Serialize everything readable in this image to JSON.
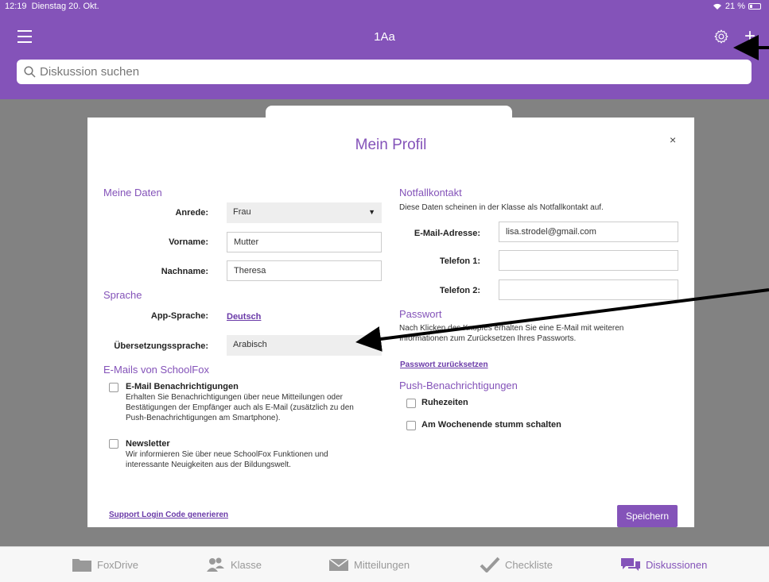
{
  "status": {
    "time": "12:19",
    "date": "Dienstag 20. Okt.",
    "battery": "21 %"
  },
  "nav": {
    "title": "1Aa",
    "menu_icon": "hamburger-icon",
    "settings_icon": "gear-icon",
    "add_label": "+"
  },
  "search": {
    "placeholder": "Diskussion suchen"
  },
  "modal": {
    "title": "Mein Profil",
    "close": "×",
    "meine_daten": {
      "heading": "Meine Daten",
      "anrede_label": "Anrede:",
      "anrede_value": "Frau",
      "vorname_label": "Vorname:",
      "vorname_value": "Mutter",
      "nachname_label": "Nachname:",
      "nachname_value": "Theresa"
    },
    "sprache": {
      "heading": "Sprache",
      "app_label": "App-Sprache:",
      "app_value": "Deutsch",
      "uebersetzung_label": "Übersetzungssprache:",
      "uebersetzung_value": "Arabisch"
    },
    "emails": {
      "heading": "E-Mails von SchoolFox",
      "benachrichtigungen_title": "E-Mail Benachrichtigungen",
      "benachrichtigungen_desc": [
        "Erhalten Sie Benachrichtigungen über neue Mitteilungen oder",
        "Bestätigungen der Empfänger auch als E-Mail (zusätzlich zu den",
        "Push-Benachrichtigungen am Smartphone)."
      ],
      "newsletter_title": "Newsletter",
      "newsletter_desc": [
        "Wir informieren Sie über neue SchoolFox Funktionen und",
        "interessante Neuigkeiten aus der Bildungswelt."
      ]
    },
    "notfall": {
      "heading": "Notfallkontakt",
      "desc": "Diese Daten scheinen in der Klasse als Notfallkontakt auf.",
      "email_label": "E-Mail-Adresse:",
      "email_value": "lisa.strodel@gmail.com",
      "tel1_label": "Telefon 1:",
      "tel1_value": "",
      "tel2_label": "Telefon 2:",
      "tel2_value": ""
    },
    "passwort": {
      "heading": "Passwort",
      "desc": [
        "Nach Klicken des Knopfes erhalten Sie eine E-Mail mit weiteren",
        "Informationen zum Zurücksetzen Ihres Passworts."
      ],
      "reset_link": "Passwort zurücksetzen"
    },
    "push": {
      "heading": "Push-Benachrichtigungen",
      "ruhezeiten": "Ruhezeiten",
      "wochenende": "Am Wochenende stumm schalten"
    },
    "support_link": "Support Login Code generieren",
    "save_label": "Speichern"
  },
  "tabs": [
    {
      "label": "FoxDrive",
      "icon": "folder-icon"
    },
    {
      "label": "Klasse",
      "icon": "people-icon"
    },
    {
      "label": "Mitteilungen",
      "icon": "envelope-icon"
    },
    {
      "label": "Checkliste",
      "icon": "checkmark-icon"
    },
    {
      "label": "Diskussionen",
      "icon": "chat-bubbles-icon",
      "active": true
    }
  ],
  "colors": {
    "brand": "#8453b9",
    "backdrop": "#828282"
  }
}
